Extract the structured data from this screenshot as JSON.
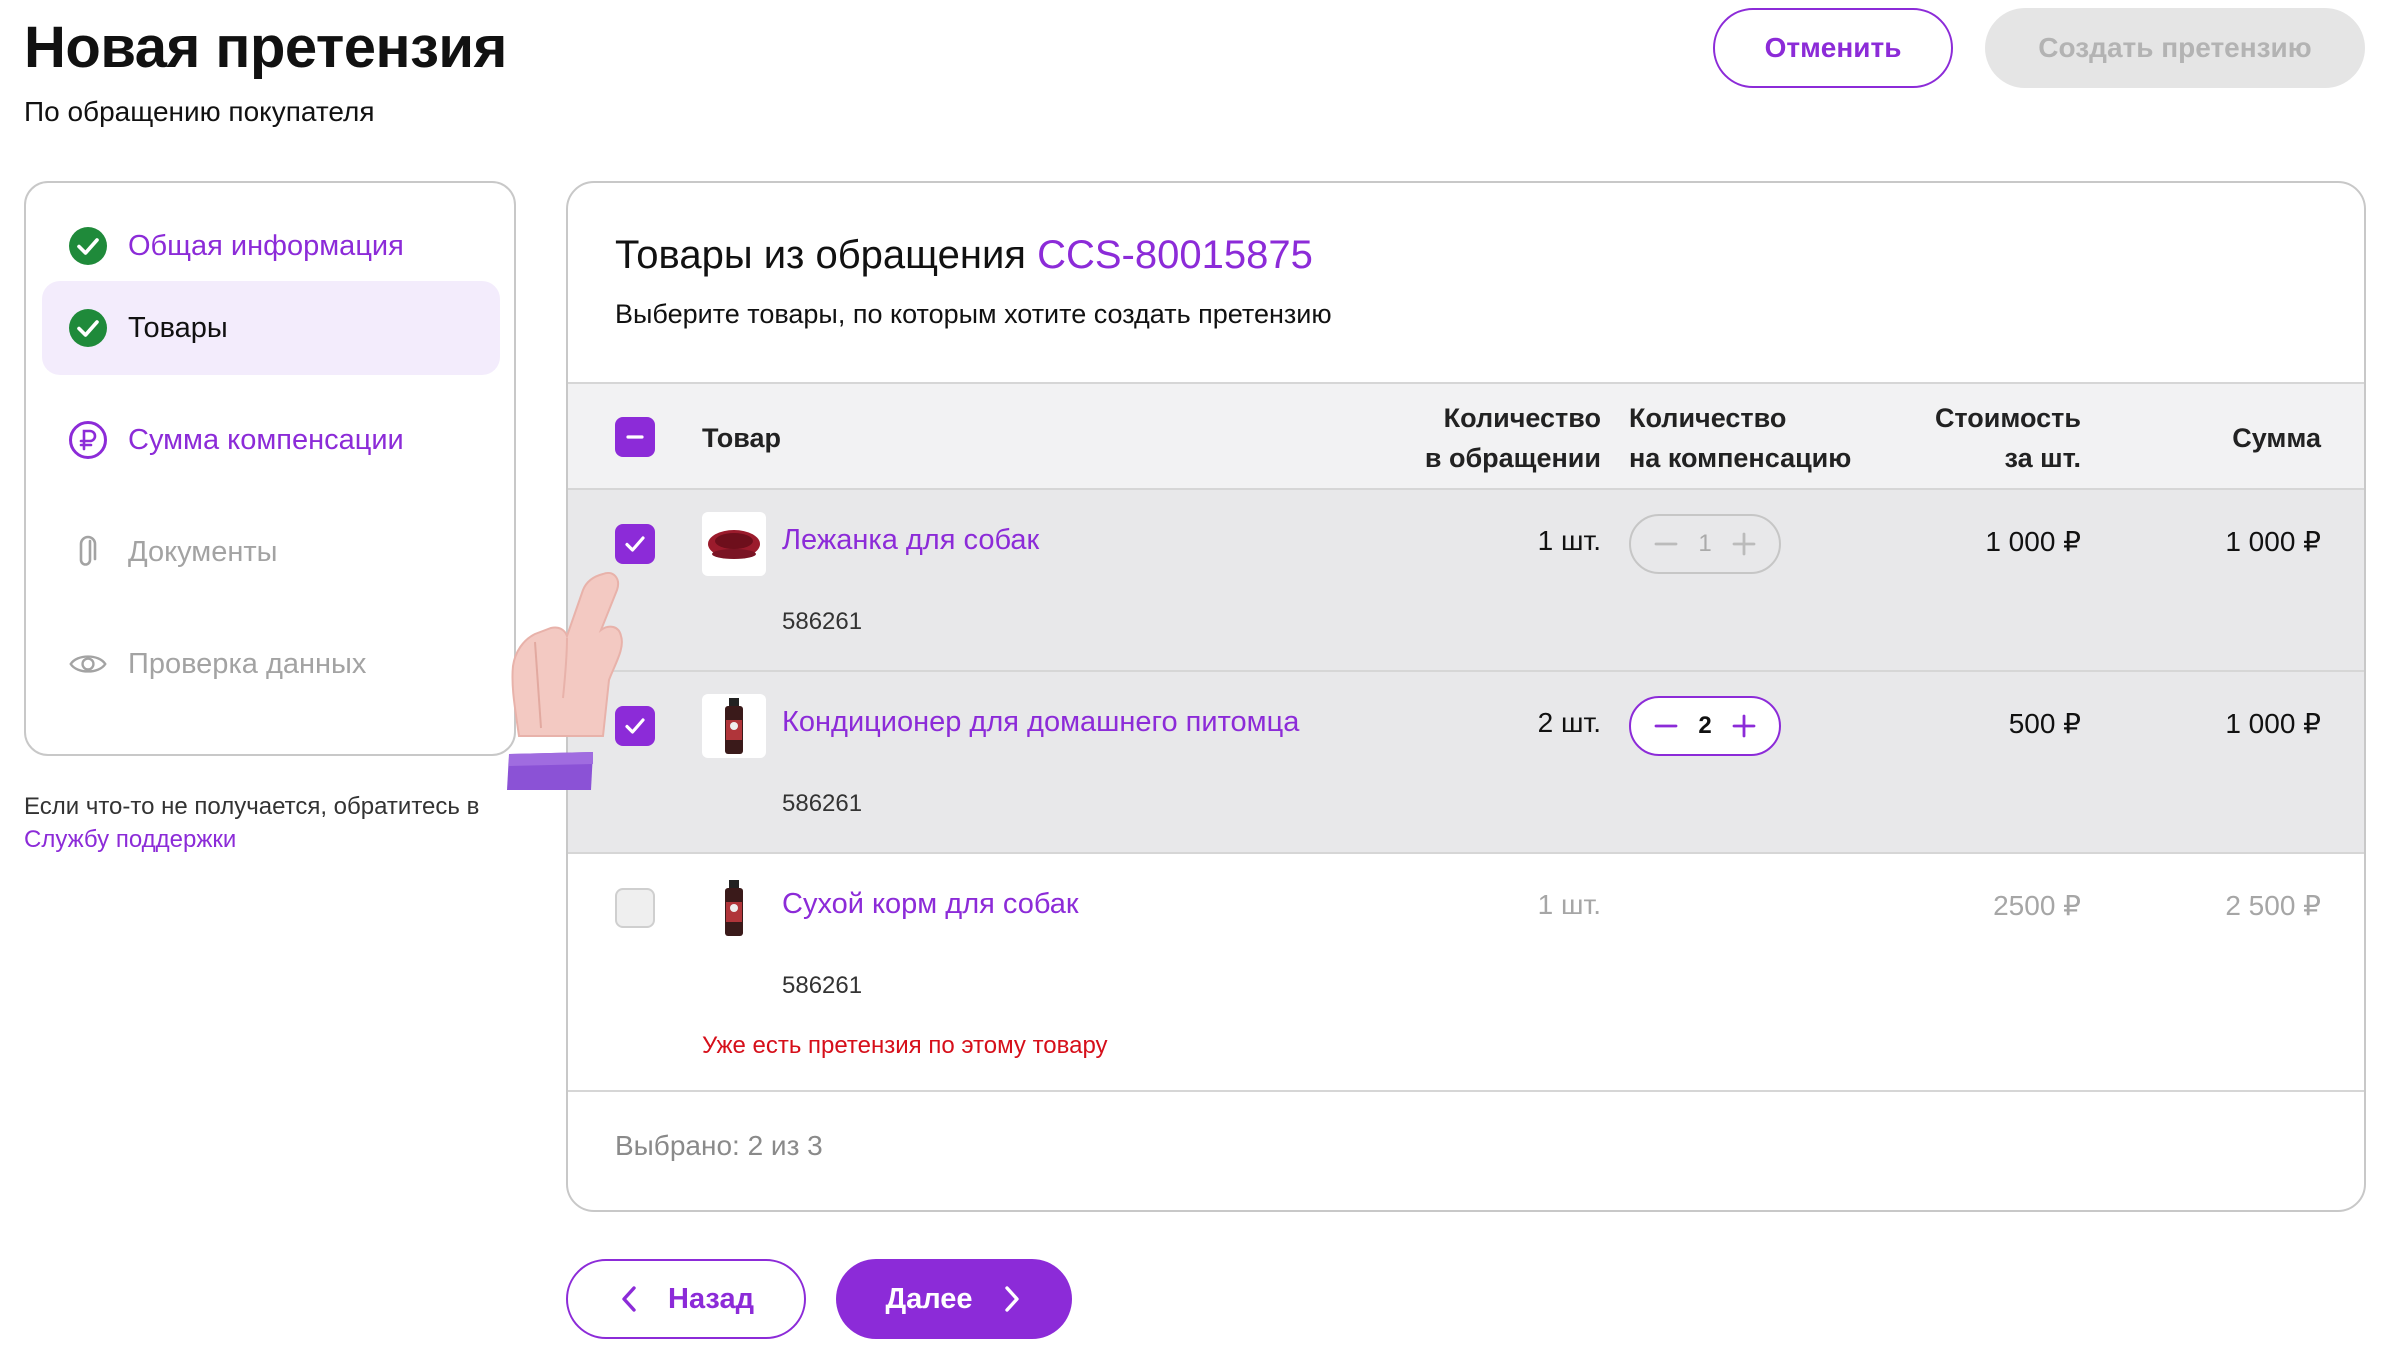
{
  "header": {
    "title": "Новая претензия",
    "subtitle": "По обращению покупателя",
    "cancel_label": "Отменить",
    "create_label": "Создать претензию"
  },
  "steps": [
    {
      "label": "Общая информация",
      "state": "done",
      "icon": "check-circle-icon"
    },
    {
      "label": "Товары",
      "state": "current",
      "icon": "check-circle-icon"
    },
    {
      "label": "Сумма компенсации",
      "state": "todo-active",
      "icon": "ruble-circle-icon"
    },
    {
      "label": "Документы",
      "state": "disabled",
      "icon": "paperclip-icon"
    },
    {
      "label": "Проверка данных",
      "state": "disabled",
      "icon": "eye-icon"
    }
  ],
  "support": {
    "text": "Если что-то не получается, обратитесь в",
    "link": "Службу поддержки"
  },
  "card": {
    "title_prefix": "Товары из обращения",
    "reference": "CCS-80015875",
    "subtitle": "Выберите товары, по которым хотите создать претензию"
  },
  "table": {
    "columns": {
      "product": "Товар",
      "qty_request_1": "Количество",
      "qty_request_2": "в обращении",
      "qty_comp_1": "Количество",
      "qty_comp_2": "на компенсацию",
      "price_1": "Стоимость",
      "price_2": "за шт.",
      "sum": "Сумма"
    },
    "rows": [
      {
        "name": "Лежанка для собак",
        "sku": "586261",
        "qty_request": "1 шт.",
        "qty_comp": "1",
        "price": "1 000 ₽",
        "sum": "1 000 ₽",
        "selected": true
      },
      {
        "name": "Кондиционер для домашнего питомца",
        "sku": "586261",
        "qty_request": "2 шт.",
        "qty_comp": "2",
        "price": "500 ₽",
        "sum": "1 000 ₽",
        "selected": true
      },
      {
        "name": "Сухой корм для собак",
        "sku": "586261",
        "qty_request": "1 шт.",
        "price": "2500 ₽",
        "sum": "2 500 ₽",
        "selected": false,
        "warning": "Уже есть претензия по этому товару"
      }
    ],
    "selected_summary": "Выбрано: 2 из 3"
  },
  "nav": {
    "back_label": "Назад",
    "next_label": "Далее"
  },
  "colors": {
    "accent": "#8c2bd8",
    "success": "#1f8a3a",
    "error": "#d60f1a"
  }
}
